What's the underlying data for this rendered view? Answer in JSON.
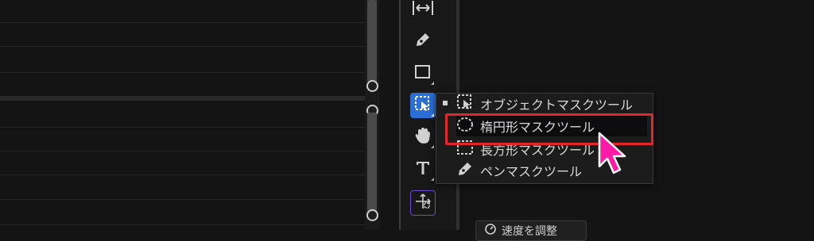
{
  "toolbar": {
    "tools": [
      {
        "name": "range-icon"
      },
      {
        "name": "pen-tool-icon"
      },
      {
        "name": "rectangle-tool-icon"
      },
      {
        "name": "object-mask-tool-icon",
        "active": true
      },
      {
        "name": "hand-tool-icon"
      },
      {
        "name": "text-tool-icon"
      },
      {
        "name": "transform-tool-icon"
      }
    ]
  },
  "flyout": {
    "items": [
      {
        "label": "オブジェクトマスクツール",
        "icon": "object-mask-icon"
      },
      {
        "label": "楕円形マスクツール",
        "icon": "ellipse-mask-icon",
        "highlighted": true
      },
      {
        "label": "長方形マスクツール",
        "icon": "rect-mask-icon"
      },
      {
        "label": "ペンマスクツール",
        "icon": "pen-mask-icon"
      }
    ]
  },
  "speed_button": {
    "label": "速度を調整"
  },
  "colors": {
    "accent": "#2b6fd6",
    "highlight": "#e3262b",
    "cursor": "#ff1aa8"
  }
}
